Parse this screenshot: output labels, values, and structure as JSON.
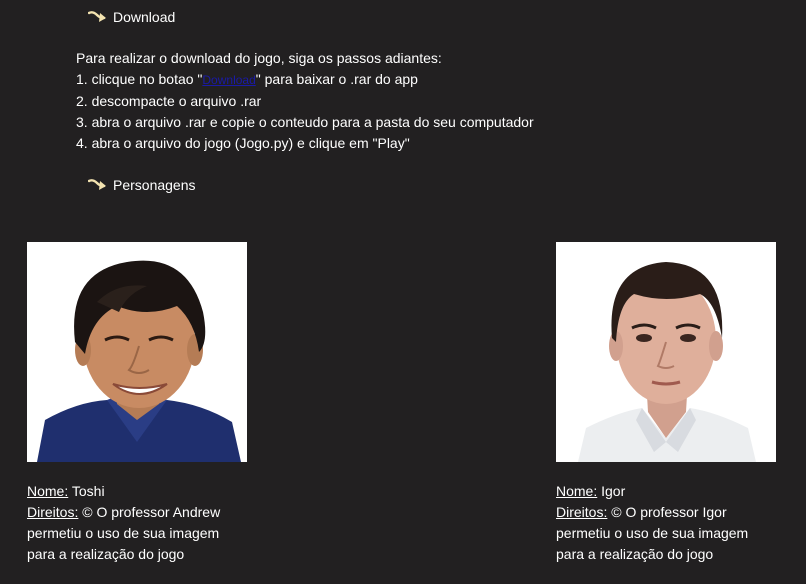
{
  "sections": {
    "download": {
      "title": "Download",
      "icon": "curved-arrow-icon"
    },
    "characters": {
      "title": "Personagens",
      "icon": "curved-arrow-icon"
    }
  },
  "instructions": {
    "intro": "Para realizar o download do jogo, siga os passos adiantes:",
    "step1_prefix": "1. clicque no botao \"",
    "step1_link": "Download",
    "step1_suffix": "\" para baixar o .rar do app",
    "step2": "2. descompacte o arquivo .rar",
    "step3": "3. abra o arquivo .rar e copie o conteudo para a pasta do seu computador",
    "step4": "4. abra o arquivo do jogo (Jogo.py) e clique em \"Play\""
  },
  "characters": [
    {
      "name_label": "Nome:",
      "name": "Toshi",
      "rights_label": "Direitos:",
      "rights_line1": "© O professor Andrew",
      "rights_line2": "permetiu o uso de sua imagem",
      "rights_line3": "para a realização do jogo"
    },
    {
      "name_label": "Nome:",
      "name": "Igor",
      "rights_label": "Direitos:",
      "rights_line1": "© O professor Igor",
      "rights_line2": "permetiu o uso de sua imagem",
      "rights_line3": "para a realização do jogo"
    }
  ],
  "colors": {
    "background": "#222021",
    "text": "#ffffff",
    "link": "#1a1aa6",
    "arrow": "#f3e3b0"
  }
}
